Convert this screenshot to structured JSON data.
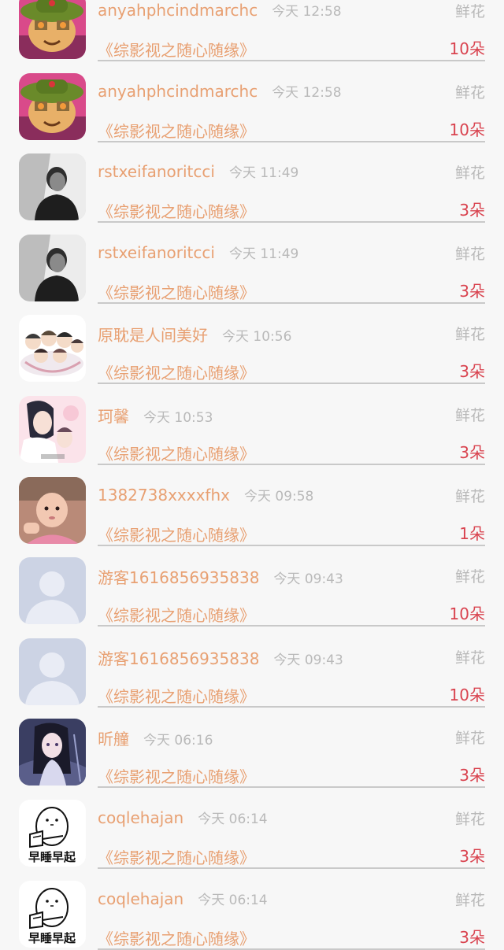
{
  "gift_label": "鲜花",
  "rows": [
    {
      "name": "anyahphcindmarchc",
      "time": "今天 12:58",
      "title": "《综影视之随心随缘》",
      "count": "10朵",
      "avatar": "teemo"
    },
    {
      "name": "anyahphcindmarchc",
      "time": "今天 12:58",
      "title": "《综影视之随心随缘》",
      "count": "10朵",
      "avatar": "teemo"
    },
    {
      "name": "rstxeifanoritcci",
      "time": "今天 11:49",
      "title": "《综影视之随心随缘》",
      "count": "3朵",
      "avatar": "bw-man"
    },
    {
      "name": "rstxeifanoritcci",
      "time": "今天 11:49",
      "title": "《综影视之随心随缘》",
      "count": "3朵",
      "avatar": "bw-man"
    },
    {
      "name": "原耽是人间美好",
      "time": "今天 10:56",
      "title": "《综影视之随心随缘》",
      "count": "3朵",
      "avatar": "group-cartoon"
    },
    {
      "name": "珂馨",
      "time": "今天 10:53",
      "title": "《综影视之随心随缘》",
      "count": "3朵",
      "avatar": "anime-couple"
    },
    {
      "name": "1382738xxxxfhx",
      "time": "今天 09:58",
      "title": "《综影视之随心随缘》",
      "count": "1朵",
      "avatar": "baby"
    },
    {
      "name": "游客1616856935838",
      "time": "今天 09:43",
      "title": "《综影视之随心随缘》",
      "count": "10朵",
      "avatar": "default"
    },
    {
      "name": "游客1616856935838",
      "time": "今天 09:43",
      "title": "《综影视之随心随缘》",
      "count": "10朵",
      "avatar": "default"
    },
    {
      "name": "昕艟",
      "time": "今天 06:16",
      "title": "《综影视之随心随缘》",
      "count": "3朵",
      "avatar": "anime-girl"
    },
    {
      "name": "coqlehajan",
      "time": "今天 06:14",
      "title": "《综影视之随心随缘》",
      "count": "3朵",
      "avatar": "early-bird"
    },
    {
      "name": "coqlehajan",
      "time": "今天 06:14",
      "title": "《综影视之随心随缘》",
      "count": "3朵",
      "avatar": "early-bird"
    }
  ],
  "avatar_texts": {
    "early-bird": "早睡早起"
  },
  "colors": {
    "name": "#e8a072",
    "count": "#d9434f",
    "meta": "#b9b9b9",
    "background": "#f7f7f7"
  }
}
